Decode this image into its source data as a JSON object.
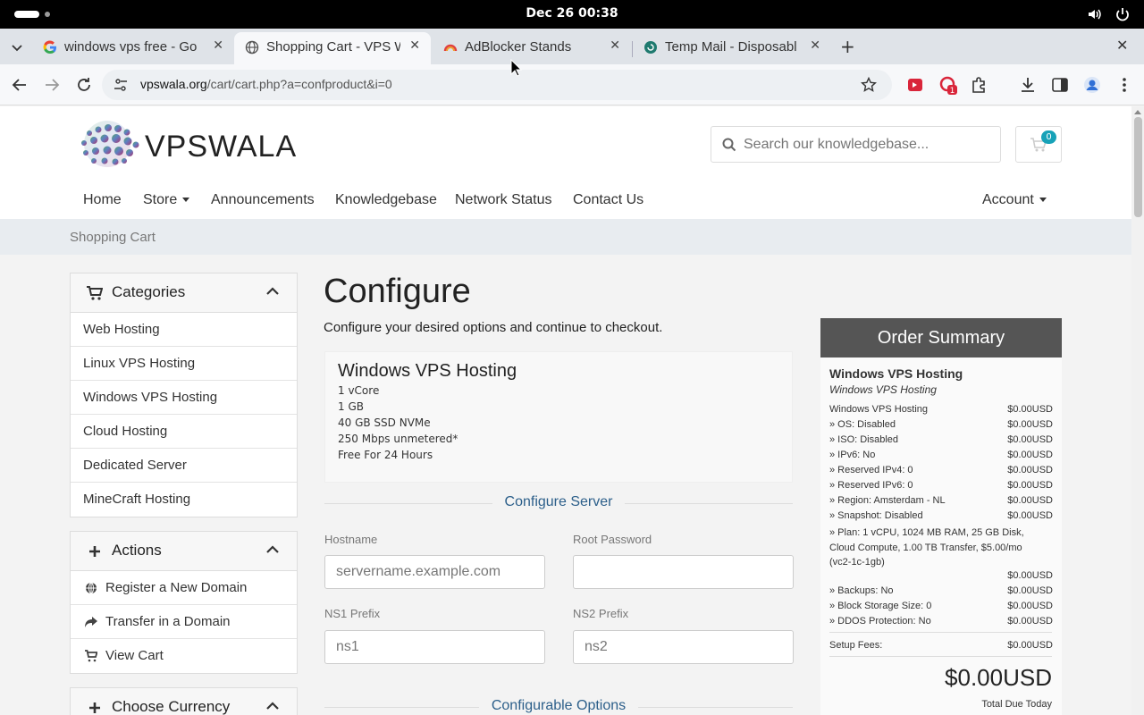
{
  "os": {
    "clock": "Dec 26  00:38"
  },
  "tabs": [
    {
      "title": "windows vps free - Go",
      "favicon": "google-icon"
    },
    {
      "title": "Shopping Cart - VPS W",
      "favicon": "globe-icon",
      "active": true
    },
    {
      "title": "AdBlocker Stands",
      "favicon": "adblocker-icon"
    },
    {
      "title": "Temp Mail - Disposabl",
      "favicon": "tempmail-icon"
    }
  ],
  "address": {
    "domain": "vpswala.org",
    "path": "/cart/cart.php?a=confproduct&i=0"
  },
  "extensions": {
    "badge": "1"
  },
  "site": {
    "logo_text": "VPSWALA",
    "search_placeholder": "Search our knowledgebase...",
    "cart_count": "0",
    "nav": [
      "Home",
      "Store",
      "Announcements",
      "Knowledgebase",
      "Network Status",
      "Contact Us"
    ],
    "account": "Account",
    "breadcrumb": "Shopping Cart"
  },
  "sidebar": {
    "categories_title": "Categories",
    "categories": [
      "Web Hosting",
      "Linux VPS Hosting",
      "Windows VPS Hosting",
      "Cloud Hosting",
      "Dedicated Server",
      "MineCraft Hosting"
    ],
    "actions_title": "Actions",
    "actions": [
      {
        "label": "Register a New Domain",
        "icon": "globe-icon"
      },
      {
        "label": "Transfer in a Domain",
        "icon": "share-icon"
      },
      {
        "label": "View Cart",
        "icon": "cart-icon"
      }
    ],
    "currency_title": "Choose Currency"
  },
  "main": {
    "title": "Configure",
    "lead": "Configure your desired options and continue to checkout.",
    "product": {
      "name": "Windows VPS Hosting",
      "features": [
        "1 vCore",
        "1 GB",
        "40 GB SSD NVMe",
        "250 Mbps unmetered*",
        "Free For 24 Hours"
      ]
    },
    "configure_server_title": "Configure Server",
    "hostname_label": "Hostname",
    "hostname_placeholder": "servername.example.com",
    "rootpw_label": "Root Password",
    "ns1_label": "NS1 Prefix",
    "ns1_value": "ns1",
    "ns2_label": "NS2 Prefix",
    "ns2_value": "ns2",
    "configurable_options_title": "Configurable Options"
  },
  "summary": {
    "title": "Order Summary",
    "product_name": "Windows VPS Hosting",
    "product_group": "Windows VPS Hosting",
    "lines": [
      {
        "desc": "Windows VPS Hosting",
        "price": "$0.00USD"
      },
      {
        "desc": " » OS: Disabled",
        "price": "$0.00USD"
      },
      {
        "desc": " » ISO: Disabled",
        "price": "$0.00USD"
      },
      {
        "desc": " » IPv6: No",
        "price": "$0.00USD"
      },
      {
        "desc": " » Reserved IPv4: 0",
        "price": "$0.00USD"
      },
      {
        "desc": " » Reserved IPv6: 0",
        "price": "$0.00USD"
      },
      {
        "desc": " » Region: Amsterdam - NL",
        "price": "$0.00USD"
      },
      {
        "desc": " » Snapshot: Disabled",
        "price": "$0.00USD"
      }
    ],
    "plan_desc": " » Plan: 1 vCPU, 1024 MB RAM, 25 GB Disk, Cloud Compute, 1.00 TB Transfer, $5.00/mo (vc2-1c-1gb)",
    "plan_price": "$0.00USD",
    "lines2": [
      {
        "desc": " » Backups: No",
        "price": "$0.00USD"
      },
      {
        "desc": " » Block Storage Size: 0",
        "price": "$0.00USD"
      },
      {
        "desc": " » DDOS Protection: No",
        "price": "$0.00USD"
      }
    ],
    "setup_label": "Setup Fees:",
    "setup_price": "$0.00USD",
    "total": "$0.00USD",
    "total_label": "Total Due Today"
  }
}
